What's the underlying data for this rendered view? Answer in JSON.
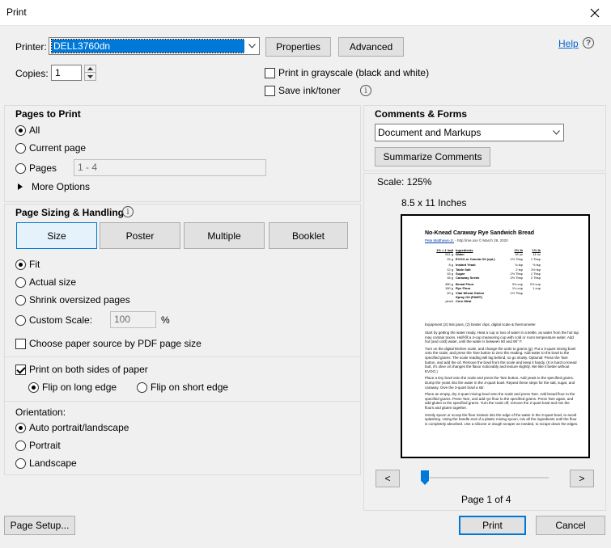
{
  "window": {
    "title": "Print"
  },
  "printer": {
    "label": "Printer:",
    "selected": "DELL3760dn",
    "properties_label": "Properties",
    "advanced_label": "Advanced",
    "help_label": "Help",
    "copies_label": "Copies:",
    "copies_value": "1",
    "grayscale_label": "Print in grayscale (black and white)",
    "grayscale_checked": false,
    "save_ink_label": "Save ink/toner",
    "save_ink_checked": false
  },
  "pages_to_print": {
    "title": "Pages to Print",
    "options": [
      "All",
      "Current page",
      "Pages"
    ],
    "selected": "All",
    "pages_placeholder": "1 - 4",
    "more_options_label": "More Options"
  },
  "page_sizing": {
    "title": "Page Sizing & Handling",
    "tabs": [
      "Size",
      "Poster",
      "Multiple",
      "Booklet"
    ],
    "active_tab": "Size",
    "fit_options": [
      "Fit",
      "Actual size",
      "Shrink oversized pages",
      "Custom Scale:"
    ],
    "selected_fit": "Fit",
    "custom_scale_value": "100",
    "percent_sign": "%",
    "paper_source_label": "Choose paper source by PDF page size",
    "paper_source_checked": false,
    "both_sides_label": "Print on both sides of paper",
    "both_sides_checked": true,
    "flip_options": [
      "Flip on long edge",
      "Flip on short edge"
    ],
    "selected_flip": "Flip on long edge",
    "orientation_label": "Orientation:",
    "orientation_options": [
      "Auto portrait/landscape",
      "Portrait",
      "Landscape"
    ],
    "selected_orientation": "Auto portrait/landscape"
  },
  "comments_forms": {
    "title": "Comments & Forms",
    "selected": "Document and Markups",
    "summarize_label": "Summarize Comments"
  },
  "preview": {
    "scale_label": "Scale: 125%",
    "paper_size": "8.5 x 11 Inches",
    "page_indicator": "Page 1 of 4",
    "prev_label": "<",
    "next_label": ">",
    "page_fraction": 0.0,
    "doc_title": "No-Knead Caraway Rye Sandwich Bread",
    "doc_byline_link": "Pete Matthews-Jr.",
    "doc_byline_rest": " - http://me.xxx  © March 29, 2020",
    "doc_table": [
      [
        "1% = 1 loaf",
        "Ingredients",
        "2% lb",
        "1% lb"
      ],
      [
        "511 g",
        "Water",
        "18 oz",
        "14 oz"
      ],
      [
        "15 g",
        "EVOO or Canola Oil (opt.)",
        "1½ Tbsp",
        "1 Tbsp"
      ],
      [
        "8 g",
        "Instant Yeast",
        "¾ tsp",
        "½ tsp"
      ],
      [
        "12 g",
        "Table Salt",
        "2 tsp",
        "1½ tsp"
      ],
      [
        "15 g",
        "Sugar",
        "1½ Tbsp",
        "1 Tbsp"
      ],
      [
        "18 g",
        "Caraway Seeds",
        "2½ Tbsp",
        "2 Tbsp"
      ],
      [
        "450 g",
        "Bread Flour",
        "3¾ cup",
        "2½ cup"
      ],
      [
        "150 g",
        "Rye Flour",
        "1¼ cup",
        "1 cup"
      ],
      [
        "20 g",
        "Vital Wheat Gluten",
        "1½ Tbsp",
        ""
      ],
      [
        "",
        "Spray Oil (PAM®)",
        "",
        ""
      ],
      [
        "pinch",
        "Corn Meal",
        "",
        ""
      ]
    ],
    "doc_equipment": "Equipment    (2) 9x5 pans, (2) binder clips, digital scale & thermometer",
    "doc_paragraphs": [
      "Start by getting the water ready. Heat a cup or two of water in a kettle, as water from the hot tap may contain toxins. Half-fill a 4-cup measuring cup with cold or room temperature water. Add hot (and cold) water, until the water is between 80 and 90° F.",
      "Turn on the digital kitchen scale, and change the units to grams (g). Put a 3-quart mixing bowl onto the scale, and press the Tare button to zero the reading. Add water to the bowl to the specified grams. The scale reading will lag behind, so go slowly. Optional: Press the Tare button, and add the oil. Remove the bowl from the scale and keep it handy. (It is hard to knead butt, it's olive oil changes the flavor noticeably and texture slightly. We like it better without EVOO.)",
      "Place a tiny bowl onto the scale and press the Tare button. Add yeast to the specified grams. Dump the yeast into the water in the 3-quart bowl. Repeat these steps for the salt, sugar, and caraway. Give the 3-quart bowl a stir.",
      "Place an empty, dry 2-quart mixing bowl onto the scale and press Tare. Add bread flour to the specified grams. Press Tare, and add rye flour to the specified grams. Press Tare again, and add gluten to the specified grams. Turn the scale off, remove the 2-quart bowl and mix the flours and gluten together.",
      "Gently spoon or scoop the flour mixture into the edge of the water in the 3-quart bowl, to avoid splashing. Using the handle end of a plastic mixing spoon, mix all the ingredients until the flour is completely absorbed. Use a silicone or dough scraper as needed, to scrape down the edges."
    ]
  },
  "footer": {
    "page_setup_label": "Page Setup...",
    "print_label": "Print",
    "cancel_label": "Cancel"
  }
}
